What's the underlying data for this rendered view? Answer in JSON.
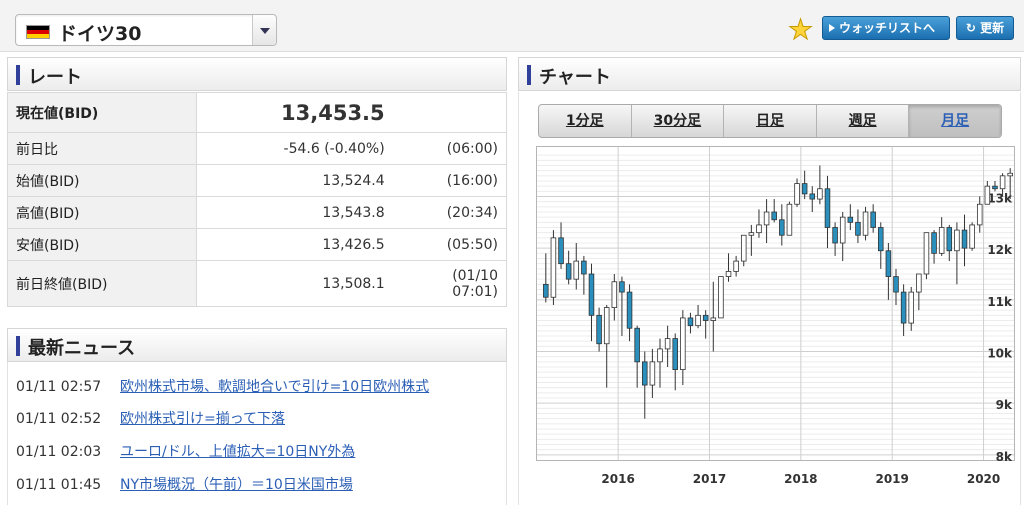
{
  "header": {
    "instrument": "ドイツ30",
    "watchlist_label": "ウォッチリストへ",
    "refresh_label": "更新"
  },
  "rate": {
    "title": "レート",
    "rows": [
      {
        "label": "現在値(BID)",
        "value": "13,453.5",
        "time": ""
      },
      {
        "label": "前日比",
        "value": "-54.6 (-0.40%)",
        "time": "(06:00)"
      },
      {
        "label": "始値(BID)",
        "value": "13,524.4",
        "time": "(16:00)"
      },
      {
        "label": "高値(BID)",
        "value": "13,543.8",
        "time": "(20:34)"
      },
      {
        "label": "安値(BID)",
        "value": "13,426.5",
        "time": "(05:50)"
      },
      {
        "label": "前日終値(BID)",
        "value": "13,508.1",
        "time_line1": "(01/10",
        "time_line2": "07:01)"
      }
    ]
  },
  "news": {
    "title": "最新ニュース",
    "items": [
      {
        "time": "01/11 02:57",
        "headline": "欧州株式市場、軟調地合いで引け=10日欧州株式"
      },
      {
        "time": "01/11 02:52",
        "headline": "欧州株式引け=揃って下落"
      },
      {
        "time": "01/11 02:03",
        "headline": "ユーロ/ドル、上値拡大=10日NY外為"
      },
      {
        "time": "01/11 01:45",
        "headline": "NY市場概況（午前）＝10日米国市場"
      }
    ]
  },
  "chart": {
    "title": "チャート",
    "tabs": [
      "1分足",
      "30分足",
      "日足",
      "週足",
      "月足"
    ],
    "active_tab": "月足"
  },
  "chart_data": {
    "type": "candlestick",
    "interval": "monthly",
    "y_ticks": [
      "8k",
      "9k",
      "10k",
      "11k",
      "12k",
      "13k"
    ],
    "x_ticks": [
      "2016",
      "2017",
      "2018",
      "2019",
      "2020"
    ],
    "ylim": [
      7900,
      13900
    ],
    "grid": true,
    "colors": {
      "down": "#2a8fbd",
      "up": "#ffffff",
      "wick": "#333333"
    },
    "ohlc": [
      [
        11300,
        11900,
        10950,
        11050
      ],
      [
        11050,
        12350,
        10900,
        12200
      ],
      [
        12200,
        12500,
        11600,
        11700
      ],
      [
        11700,
        11950,
        11300,
        11400
      ],
      [
        11400,
        12100,
        11200,
        11750
      ],
      [
        11750,
        11850,
        11100,
        11500
      ],
      [
        11500,
        11700,
        10200,
        10700
      ],
      [
        10700,
        10850,
        10000,
        10150
      ],
      [
        10150,
        10900,
        9300,
        10850
      ],
      [
        10850,
        11500,
        10600,
        11350
      ],
      [
        11350,
        11450,
        10300,
        11150
      ],
      [
        11150,
        11300,
        10200,
        10450
      ],
      [
        10450,
        10500,
        9300,
        9800
      ],
      [
        9800,
        10000,
        8700,
        9350
      ],
      [
        9350,
        10050,
        9100,
        9800
      ],
      [
        9800,
        10250,
        9300,
        10050
      ],
      [
        10050,
        10500,
        9700,
        10250
      ],
      [
        10250,
        10350,
        9250,
        9650
      ],
      [
        9650,
        10800,
        9350,
        10650
      ],
      [
        10650,
        10750,
        10350,
        10500
      ],
      [
        10500,
        10900,
        10450,
        10700
      ],
      [
        10700,
        10800,
        10250,
        10600
      ],
      [
        10600,
        11350,
        10000,
        10650
      ],
      [
        10650,
        11450,
        10650,
        11450
      ],
      [
        11450,
        11900,
        11350,
        11550
      ],
      [
        11550,
        11850,
        11450,
        11750
      ],
      [
        11750,
        12250,
        11650,
        12250
      ],
      [
        12250,
        12450,
        11850,
        12300
      ],
      [
        12300,
        12750,
        12200,
        12450
      ],
      [
        12450,
        12950,
        12100,
        12700
      ],
      [
        12700,
        12950,
        12500,
        12550
      ],
      [
        12550,
        12850,
        12050,
        12250
      ],
      [
        12250,
        12900,
        12250,
        12850
      ],
      [
        12850,
        13350,
        12800,
        13250
      ],
      [
        13250,
        13500,
        12950,
        13050
      ],
      [
        13050,
        13200,
        12700,
        12950
      ],
      [
        12950,
        13600,
        12850,
        13150
      ],
      [
        13150,
        13400,
        12000,
        12400
      ],
      [
        12400,
        12500,
        11850,
        12100
      ],
      [
        12100,
        12700,
        11750,
        12600
      ],
      [
        12600,
        12850,
        12350,
        12500
      ],
      [
        12500,
        12750,
        12100,
        12250
      ],
      [
        12250,
        12800,
        12150,
        12700
      ],
      [
        12700,
        12850,
        12300,
        12400
      ],
      [
        12400,
        12500,
        11600,
        11950
      ],
      [
        11950,
        12100,
        11000,
        11450
      ],
      [
        11450,
        11600,
        10900,
        11150
      ],
      [
        11150,
        11300,
        10300,
        10550
      ],
      [
        10550,
        11250,
        10400,
        11150
      ],
      [
        11150,
        11450,
        10800,
        11500
      ],
      [
        11500,
        12200,
        11400,
        12300
      ],
      [
        12300,
        12350,
        11700,
        11900
      ],
      [
        11900,
        12600,
        11850,
        12400
      ],
      [
        12400,
        12450,
        11750,
        11950
      ],
      [
        11950,
        12500,
        11300,
        12350
      ],
      [
        12350,
        12650,
        11650,
        12000
      ],
      [
        12000,
        12500,
        11950,
        12450
      ],
      [
        12450,
        13000,
        12300,
        12850
      ],
      [
        12850,
        13300,
        12900,
        13200
      ],
      [
        13200,
        13300,
        13100,
        13150
      ],
      [
        13150,
        13450,
        13000,
        13400
      ],
      [
        13400,
        13550,
        12950,
        13450
      ]
    ]
  }
}
